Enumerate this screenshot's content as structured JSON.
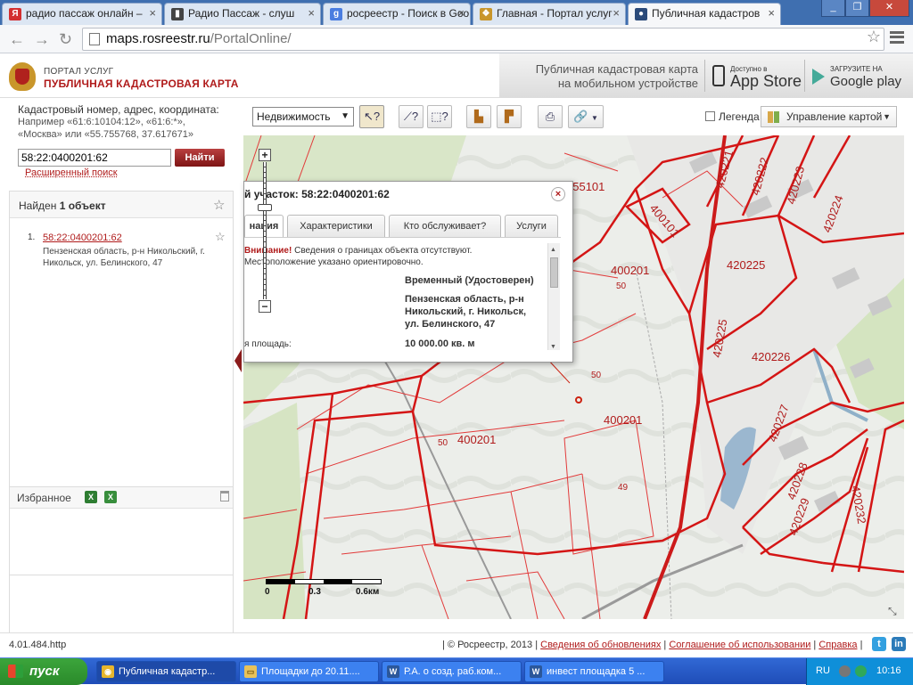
{
  "browser": {
    "tabs": [
      {
        "title": "радио пассаж онлайн –",
        "icon": "yandex-icon",
        "color": "#d32f2f",
        "glyph": "Я"
      },
      {
        "title": "Радио Пассаж - слуш",
        "icon": "radio-icon",
        "color": "#444444",
        "glyph": "▮"
      },
      {
        "title": "росреестр - Поиск в Goo",
        "icon": "google-icon",
        "color": "#4a7de0",
        "glyph": "g"
      },
      {
        "title": "Главная - Портал услуг",
        "icon": "emblem-icon",
        "color": "#c9962b",
        "glyph": "❖"
      },
      {
        "title": "Публичная кадастров",
        "icon": "globe-icon",
        "color": "#2b4a7a",
        "glyph": "●"
      }
    ],
    "url_host": "maps.rosreestr.ru",
    "url_path": "/PortalOnline/"
  },
  "header": {
    "portal_sub": "ПОРТАЛ УСЛУГ",
    "portal_title": "ПУБЛИЧНАЯ КАДАСТРОВАЯ КАРТА",
    "promo_line1": "Публичная кадастровая карта",
    "promo_line2": "на мобильном устройстве",
    "appstore_small": "Доступно в",
    "appstore_big": "App Store",
    "gplay_small": "ЗАГРУЗИТЕ НА",
    "gplay_big": "Google play"
  },
  "search": {
    "hint_title": "Кадастровый номер, адрес, координата:",
    "hint_examples1": "Например «61:6:10104:12», «61:6:*»,",
    "hint_examples2": "«Москва» или «55.755768, 37.617671»",
    "value": "58:22:0400201:62",
    "find_label": "Найти",
    "advanced_label": "Расширенный поиск"
  },
  "results": {
    "found_prefix": "Найден ",
    "found_count": "1 объект",
    "items": [
      {
        "num": "1.",
        "link": "58:22:0400201:62",
        "address": "Пензенская область, р-н Никольский, г. Никольск, ул. Белинского, 47"
      }
    ]
  },
  "favorites": {
    "title": "Избранное"
  },
  "map_toolbar": {
    "layer_value": "Недвижимость",
    "legend_label": "Легенда",
    "map_mgmt_label": "Управление картой"
  },
  "popup": {
    "title": "й участок: 58:22:0400201:62",
    "tabs": [
      "нация",
      "Характеристики",
      "Кто обслуживает?",
      "Услуги"
    ],
    "warn_strong": "Внимание!",
    "warn_text": " Сведения о границах объекта отсутствуют.",
    "warn_text2": "Местоположение указано ориентировочно.",
    "status_value": "Временный (Удостоверен)",
    "address_value": "Пензенская область, р-н Никольский, г. Никольск, ул. Белинского, 47",
    "area_label": "я площадь:",
    "area_value": "10 000.00 кв. м"
  },
  "map": {
    "labels": [
      "255101",
      "400101",
      "400201",
      "50",
      "420221",
      "420222",
      "420223",
      "420224",
      "420225",
      "420225",
      "420226",
      "420227",
      "420228",
      "420229",
      "420232",
      "50",
      "400201",
      "50",
      "400201",
      "49"
    ],
    "scale_labels": [
      "0",
      "0.3",
      "0.6км"
    ]
  },
  "footer": {
    "version": "4.01.484.http",
    "copyright": "| © Росреестр, 2013 |",
    "link1": "Сведения об обновлениях",
    "link2": "Соглашение об использовании",
    "link3": "Справка",
    "sep": "|"
  },
  "taskbar": {
    "start_label": "пуск",
    "tasks": [
      {
        "label": "Публичная кадастр...",
        "icon": "chrome-icon",
        "color": "#e8b62c",
        "glyph": "◉"
      },
      {
        "label": "Площадки до 20.11....",
        "icon": "folder-icon",
        "color": "#e8c25a",
        "glyph": "▭"
      },
      {
        "label": "Р.А. о созд. раб.ком...",
        "icon": "word-icon",
        "color": "#2b579a",
        "glyph": "W"
      },
      {
        "label": "инвест площадка 5 ...",
        "icon": "word-icon",
        "color": "#2b579a",
        "glyph": "W"
      }
    ],
    "lang": "RU",
    "clock": "10:16"
  }
}
